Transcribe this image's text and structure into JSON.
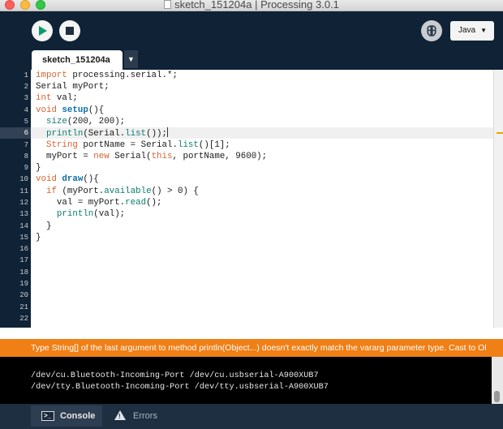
{
  "window": {
    "title": "sketch_151204a | Processing 3.0.1"
  },
  "toolbar": {
    "mode_label": "Java",
    "mode_caret": "▼"
  },
  "tabs": [
    {
      "label": "sketch_151204a"
    }
  ],
  "tab_menu_caret": "▼",
  "editor": {
    "line_numbers": [
      "1",
      "2",
      "3",
      "4",
      "5",
      "6",
      "7",
      "8",
      "9",
      "10",
      "11",
      "12",
      "13",
      "14",
      "15",
      "16",
      "17",
      "18",
      "19",
      "20",
      "21",
      "22"
    ],
    "lines": [
      "import processing.serial.*;",
      "Serial myPort;",
      "int val;",
      "void setup(){",
      "  size(200, 200);",
      "  println(Serial.list());",
      "  String portName = Serial.list()[1];",
      "  myPort = new Serial(this, portName, 9600);",
      "}",
      "void draw(){",
      "  if (myPort.available() > 0) {",
      "    val = myPort.read();",
      "    println(val);",
      "  }",
      "}"
    ],
    "current_line": 6
  },
  "status": {
    "error_message": "Type String[] of the last argument to method println(Object...) doesn't exactly match the vararg parameter type. Cast to Ol"
  },
  "console": {
    "lines": [
      "/dev/cu.Bluetooth-Incoming-Port /dev/cu.usbserial-A900XUB7",
      "/dev/tty.Bluetooth-Incoming-Port /dev/tty.usbserial-A900XUB7"
    ]
  },
  "footer": {
    "console_label": "Console",
    "errors_label": "Errors"
  },
  "colors": {
    "accent_run": "#0b9b6a",
    "error_bar": "#f07f16",
    "background": "#0f2236"
  }
}
